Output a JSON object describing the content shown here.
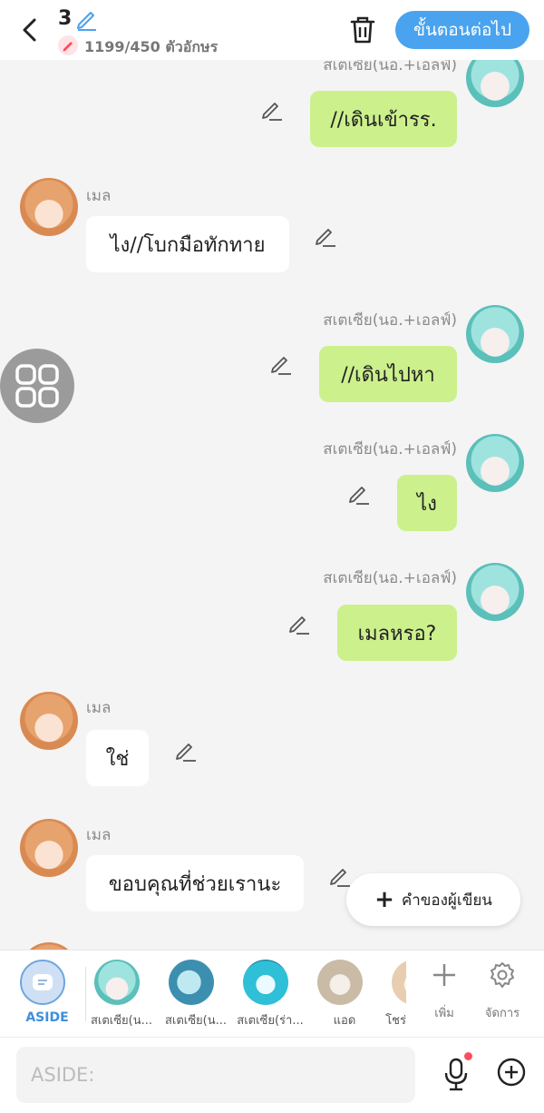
{
  "header": {
    "episode_number": "3",
    "char_count": "1199/450 ตัวอักษร",
    "next_button": "ขั้นตอนต่อไป"
  },
  "messages": [
    {
      "side": "right",
      "name": "สเตเซีย(นอ.+เอลฟ์)",
      "text": "//เดินเข้ารร."
    },
    {
      "side": "left",
      "name": "เมล",
      "text": "ไง//โบกมือทักทาย"
    },
    {
      "side": "right",
      "name": "สเตเซีย(นอ.+เอลฟ์)",
      "text": "//เดินไปหา"
    },
    {
      "side": "right",
      "name": "สเตเซีย(นอ.+เอลฟ์)",
      "text": "ไง"
    },
    {
      "side": "right",
      "name": "สเตเซีย(นอ.+เอลฟ์)",
      "text": "เมลหรอ?"
    },
    {
      "side": "left",
      "name": "เมล",
      "text": "ใช่"
    },
    {
      "side": "left",
      "name": "เมล",
      "text": "ขอบคุณที่ช่วยเรานะ"
    }
  ],
  "author_note_button": "คำของผู้เขียน",
  "character_bar": {
    "aside_label": "ASIDE",
    "characters": [
      {
        "label": "สเตเซีย(น..."
      },
      {
        "label": "สเตเซีย(น..."
      },
      {
        "label": "สเตเซีย(ร่า..."
      },
      {
        "label": "แอด"
      },
      {
        "label": "โชร่"
      }
    ],
    "add_label": "เพิ่ม",
    "manage_label": "จัดการ"
  },
  "input": {
    "placeholder": "ASIDE:"
  },
  "colors": {
    "accent": "#4aa3ee",
    "right_bubble": "#ccf08c",
    "left_bubble": "#ffffff",
    "notification_dot": "#ff4e5e"
  },
  "icons": [
    "back-arrow-icon",
    "pencil-icon",
    "trash-icon",
    "grid-menu-icon",
    "plus-icon",
    "gear-icon",
    "microphone-icon",
    "add-circle-icon"
  ]
}
